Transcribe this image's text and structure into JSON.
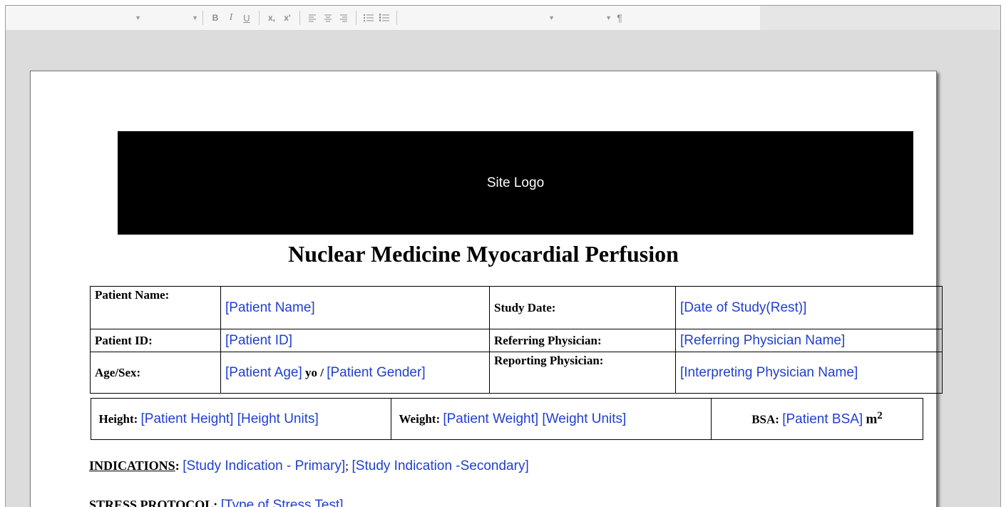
{
  "toolbar": {
    "buttons": {
      "bold": "B",
      "italic": "I",
      "underline": "U",
      "subscript": "x,",
      "superscript": "x'",
      "pilcrow": "¶"
    }
  },
  "document": {
    "logo_text": "Site Logo",
    "title": "Nuclear Medicine Myocardial Perfusion",
    "fields": {
      "patient_name_label": "Patient Name:",
      "patient_name_value": "[Patient Name]",
      "study_date_label": "Study Date:",
      "study_date_value": "[Date of Study(Rest)]",
      "patient_id_label": "Patient ID:",
      "patient_id_value": "[Patient ID]",
      "referring_label": "Referring Physician:",
      "referring_value": "[Referring Physician Name]",
      "age_sex_label": "Age/Sex:",
      "age_value": "[Patient Age]",
      "age_suffix": "yo /",
      "gender_value": "[Patient Gender]",
      "reporting_label": "Reporting Physician:",
      "reporting_value": "[Interpreting Physician Name]",
      "height_label": "Height:",
      "height_value": "[Patient Height] [Height Units]",
      "weight_label": "Weight:",
      "weight_value": "[Patient Weight] [Weight Units]",
      "bsa_label": "BSA:",
      "bsa_value": "[Patient BSA]",
      "bsa_unit": "m",
      "bsa_exp": "2"
    },
    "indications_label": "INDICATIONS",
    "indications_colon": ":",
    "indication_primary": "[Study Indication - Primary]",
    "indication_sep": ";",
    "indication_secondary": "[Study Indication -Secondary]",
    "stress_label": "STRESS PROTOCOL:",
    "stress_value": "[Type of Stress Test]"
  }
}
